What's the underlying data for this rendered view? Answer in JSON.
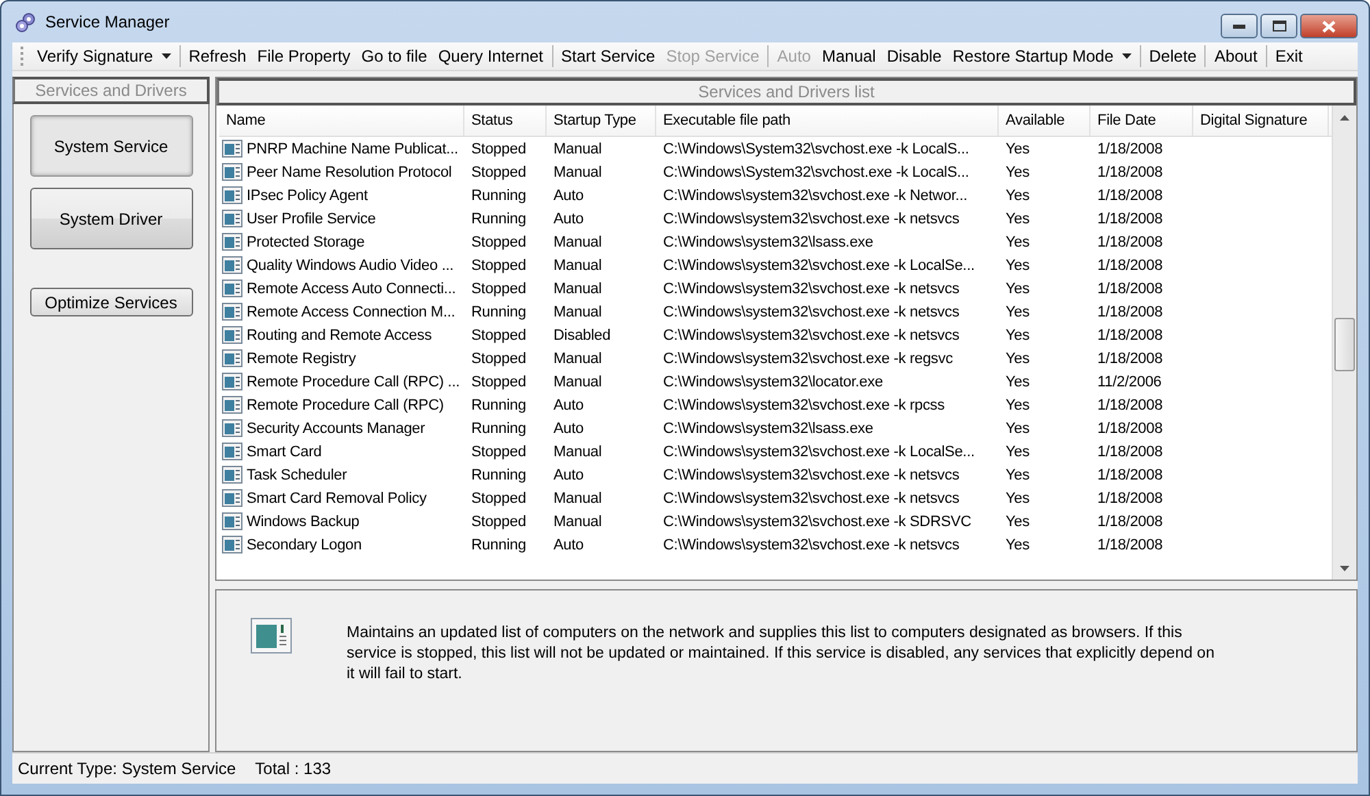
{
  "window": {
    "title": "Service Manager"
  },
  "toolbar": [
    {
      "kind": "dropdown",
      "label": "Verify Signature",
      "disabled": false
    },
    {
      "kind": "separator"
    },
    {
      "kind": "button",
      "label": "Refresh",
      "disabled": false
    },
    {
      "kind": "button",
      "label": "File Property",
      "disabled": false
    },
    {
      "kind": "button",
      "label": "Go to file",
      "disabled": false
    },
    {
      "kind": "button",
      "label": "Query Internet",
      "disabled": false
    },
    {
      "kind": "separator"
    },
    {
      "kind": "button",
      "label": "Start Service",
      "disabled": false
    },
    {
      "kind": "button",
      "label": "Stop Service",
      "disabled": true
    },
    {
      "kind": "separator"
    },
    {
      "kind": "button",
      "label": "Auto",
      "disabled": true
    },
    {
      "kind": "button",
      "label": "Manual",
      "disabled": false
    },
    {
      "kind": "button",
      "label": "Disable",
      "disabled": false
    },
    {
      "kind": "dropdown",
      "label": "Restore Startup Mode",
      "disabled": false
    },
    {
      "kind": "separator"
    },
    {
      "kind": "button",
      "label": "Delete",
      "disabled": false
    },
    {
      "kind": "separator"
    },
    {
      "kind": "button",
      "label": "About",
      "disabled": false
    },
    {
      "kind": "separator"
    },
    {
      "kind": "button",
      "label": "Exit",
      "disabled": false
    }
  ],
  "sidebar": {
    "title": "Services and Drivers",
    "buttons": [
      {
        "label": "System Service",
        "selected": true
      },
      {
        "label": "System Driver",
        "selected": false
      }
    ],
    "optimize_button": "Optimize Services"
  },
  "list": {
    "title": "Services and Drivers list",
    "columns": [
      "Name",
      "Status",
      "Startup Type",
      "Executable file path",
      "Available",
      "File Date",
      "Digital Signature"
    ],
    "rows": [
      [
        "PNRP Machine Name Publicat...",
        "Stopped",
        "Manual",
        "C:\\Windows\\System32\\svchost.exe -k LocalS...",
        "Yes",
        "1/18/2008"
      ],
      [
        "Peer Name Resolution Protocol",
        "Stopped",
        "Manual",
        "C:\\Windows\\System32\\svchost.exe -k LocalS...",
        "Yes",
        "1/18/2008"
      ],
      [
        "IPsec Policy Agent",
        "Running",
        "Auto",
        "C:\\Windows\\system32\\svchost.exe -k Networ...",
        "Yes",
        "1/18/2008"
      ],
      [
        "User Profile Service",
        "Running",
        "Auto",
        "C:\\Windows\\system32\\svchost.exe -k netsvcs",
        "Yes",
        "1/18/2008"
      ],
      [
        "Protected Storage",
        "Stopped",
        "Manual",
        "C:\\Windows\\system32\\lsass.exe",
        "Yes",
        "1/18/2008"
      ],
      [
        "Quality Windows Audio Video ...",
        "Stopped",
        "Manual",
        "C:\\Windows\\system32\\svchost.exe -k LocalSe...",
        "Yes",
        "1/18/2008"
      ],
      [
        "Remote Access Auto Connecti...",
        "Stopped",
        "Manual",
        "C:\\Windows\\system32\\svchost.exe -k netsvcs",
        "Yes",
        "1/18/2008"
      ],
      [
        "Remote Access Connection M...",
        "Running",
        "Manual",
        "C:\\Windows\\system32\\svchost.exe -k netsvcs",
        "Yes",
        "1/18/2008"
      ],
      [
        "Routing and Remote Access",
        "Stopped",
        "Disabled",
        "C:\\Windows\\system32\\svchost.exe -k netsvcs",
        "Yes",
        "1/18/2008"
      ],
      [
        "Remote Registry",
        "Stopped",
        "Manual",
        "C:\\Windows\\system32\\svchost.exe -k regsvc",
        "Yes",
        "1/18/2008"
      ],
      [
        "Remote Procedure Call (RPC) ...",
        "Stopped",
        "Manual",
        "C:\\Windows\\system32\\locator.exe",
        "Yes",
        "11/2/2006"
      ],
      [
        "Remote Procedure Call (RPC)",
        "Running",
        "Auto",
        "C:\\Windows\\system32\\svchost.exe -k rpcss",
        "Yes",
        "1/18/2008"
      ],
      [
        "Security Accounts Manager",
        "Running",
        "Auto",
        "C:\\Windows\\system32\\lsass.exe",
        "Yes",
        "1/18/2008"
      ],
      [
        "Smart Card",
        "Stopped",
        "Manual",
        "C:\\Windows\\system32\\svchost.exe -k LocalSe...",
        "Yes",
        "1/18/2008"
      ],
      [
        "Task Scheduler",
        "Running",
        "Auto",
        "C:\\Windows\\system32\\svchost.exe -k netsvcs",
        "Yes",
        "1/18/2008"
      ],
      [
        "Smart Card Removal Policy",
        "Stopped",
        "Manual",
        "C:\\Windows\\system32\\svchost.exe -k netsvcs",
        "Yes",
        "1/18/2008"
      ],
      [
        "Windows Backup",
        "Stopped",
        "Manual",
        "C:\\Windows\\system32\\svchost.exe -k SDRSVC",
        "Yes",
        "1/18/2008"
      ],
      [
        "Secondary Logon",
        "Running",
        "Auto",
        "C:\\Windows\\system32\\svchost.exe -k netsvcs",
        "Yes",
        "1/18/2008"
      ]
    ]
  },
  "description": "Maintains an updated list of computers on the network and supplies this list to computers designated as browsers. If this service is stopped, this list will not be updated or maintained. If this service is disabled, any services that explicitly depend on it will fail to start.",
  "status_bar": [
    "Current Type: System Service",
    "Total : 133"
  ]
}
